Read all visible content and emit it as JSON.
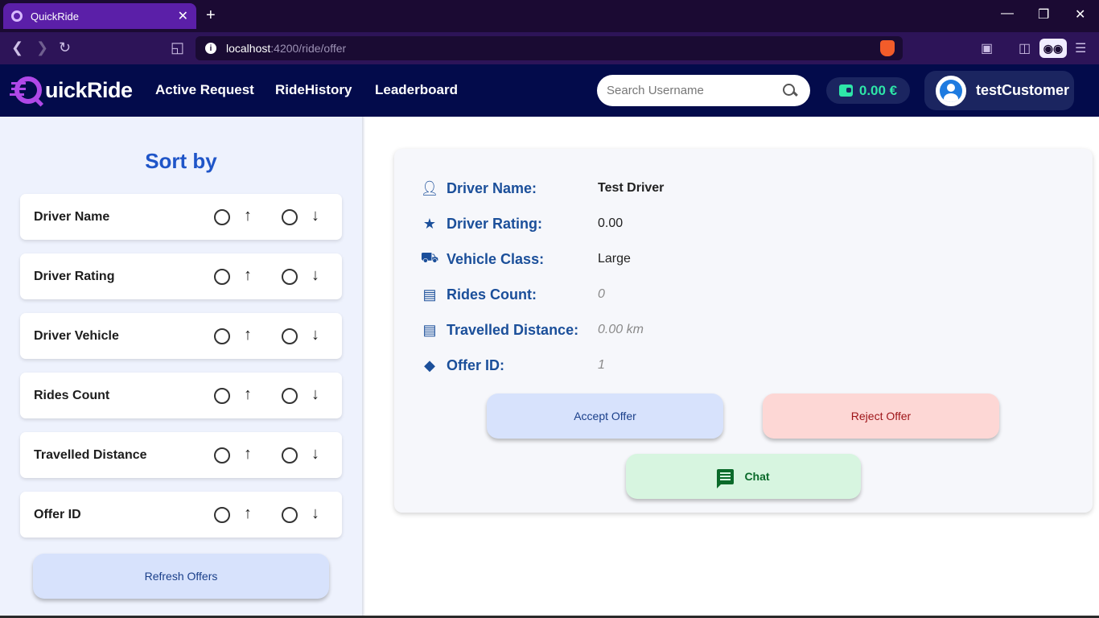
{
  "browser": {
    "tab_title": "QuickRide",
    "tab_close": "✕",
    "new_tab": "+",
    "url_host": "localhost",
    "url_path": ":4200/ride/offer",
    "brave_badge": "1",
    "window_controls": {
      "minimize": "—",
      "restore": "❐",
      "close": "✕"
    }
  },
  "header": {
    "logo_text": "uickRide",
    "nav": [
      "Active Request",
      "RideHistory",
      "Leaderboard"
    ],
    "search_placeholder": "Search Username",
    "wallet_balance": "0.00 €",
    "username": "testCustomer"
  },
  "sidebar": {
    "title": "Sort by",
    "sort_options": [
      "Driver Name",
      "Driver Rating",
      "Driver Vehicle",
      "Rides Count",
      "Travelled Distance",
      "Offer ID"
    ],
    "up_arrow": "↑",
    "down_arrow": "↓",
    "refresh_label": "Refresh Offers"
  },
  "offer": {
    "fields": [
      {
        "label": "Driver Name:",
        "value": "Test Driver",
        "icon": "person-icon"
      },
      {
        "label": "Driver Rating:",
        "value": "0.00",
        "icon": "star-icon"
      },
      {
        "label": "Vehicle Class:",
        "value": "Large",
        "icon": "car-icon"
      },
      {
        "label": "Rides Count:",
        "value": "0",
        "icon": "clipboard-icon"
      },
      {
        "label": "Travelled Distance:",
        "value": "0.00 km",
        "icon": "map-icon"
      },
      {
        "label": "Offer ID:",
        "value": "1",
        "icon": "tag-icon"
      }
    ],
    "accept_label": "Accept Offer",
    "reject_label": "Reject Offer",
    "chat_label": "Chat"
  },
  "colors": {
    "header_bg": "#030b4b",
    "accent_blue": "#1f55c8",
    "label_blue": "#1b4f9a",
    "wallet_green": "#2ee6a8",
    "accept_bg": "#d7e2fc",
    "reject_bg": "#fdd7d5",
    "chat_bg": "#d7f5e0"
  }
}
